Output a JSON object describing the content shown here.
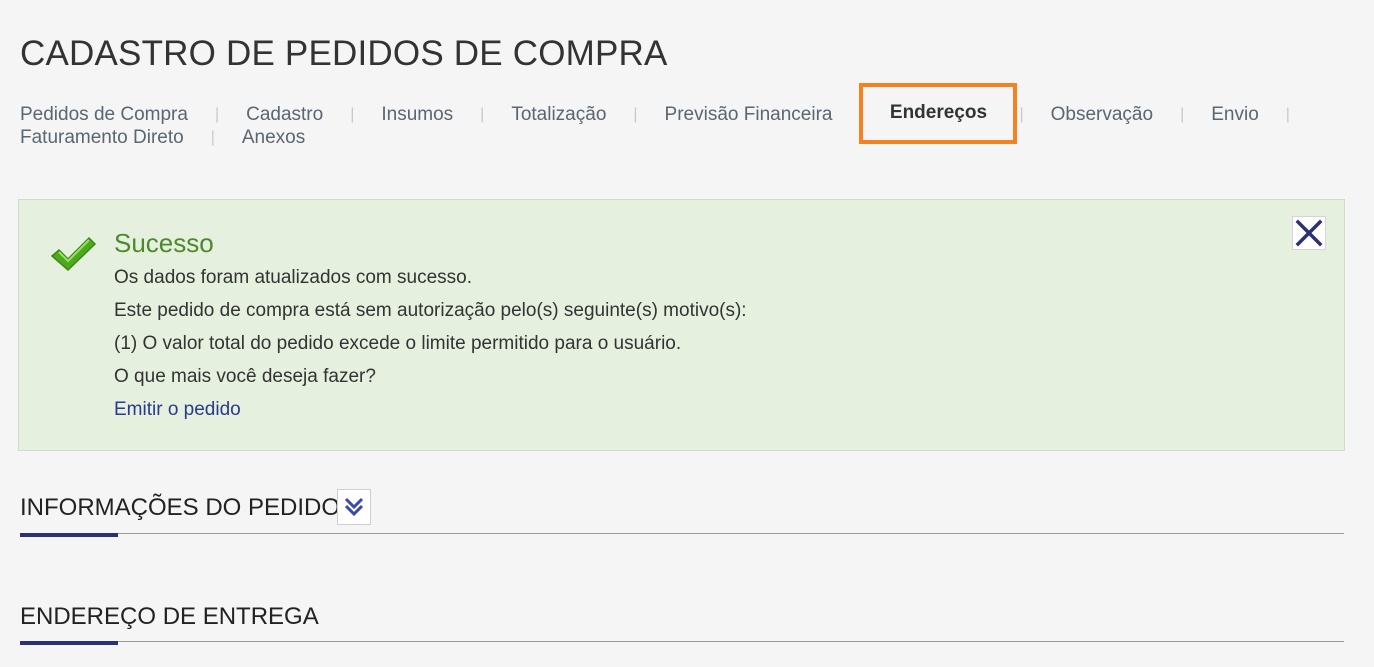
{
  "page": {
    "title": "CADASTRO DE PEDIDOS DE COMPRA"
  },
  "tabs": [
    {
      "label": "Pedidos de Compra"
    },
    {
      "label": "Cadastro"
    },
    {
      "label": "Insumos"
    },
    {
      "label": "Totalização"
    },
    {
      "label": "Previsão Financeira"
    },
    {
      "label": "Endereços",
      "active": true
    },
    {
      "label": "Observação"
    },
    {
      "label": "Envio"
    },
    {
      "label": "Faturamento Direto"
    },
    {
      "label": "Anexos"
    }
  ],
  "alert": {
    "title": "Sucesso",
    "lines": [
      "Os dados foram atualizados com sucesso.",
      "Este pedido de compra está sem autorização pelo(s) seguinte(s) motivo(s):",
      "(1) O valor total do pedido excede o limite permitido para o usuário.",
      "O que mais você deseja fazer?"
    ],
    "link": "Emitir o pedido",
    "icon": "check-icon",
    "close_icon": "close-icon"
  },
  "sections": {
    "info": {
      "title": "INFORMAÇÕES DO PEDIDO",
      "toggle_icon": "double-chevron-down-icon"
    },
    "delivery": {
      "title": "ENDEREÇO DE ENTREGA"
    }
  },
  "colors": {
    "highlight": "#f58220",
    "success_bg": "#e5f0df",
    "success_title": "#4e8a2a",
    "accent": "#2b3173",
    "link": "#2b3a8a"
  }
}
